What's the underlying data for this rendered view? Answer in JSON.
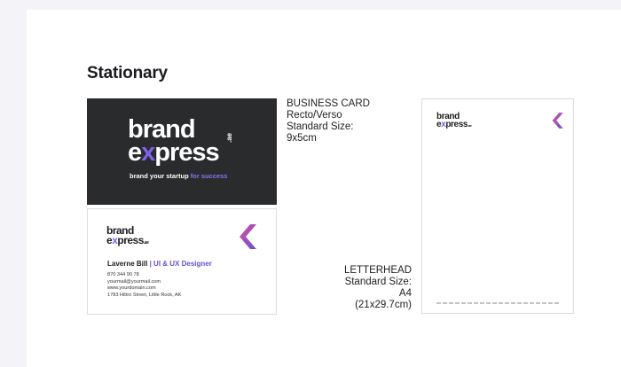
{
  "page": {
    "title": "Stationary"
  },
  "business_card": {
    "front": {
      "brand_line1": "brand",
      "brand_line2_pre": "e",
      "brand_line2_x": "x",
      "brand_line2_post": "press",
      "brand_suffix": ".ae",
      "tagline": "brand your startup",
      "tagline_accent": "for success"
    },
    "back": {
      "brand_line1": "brand",
      "brand_line2_pre": "e",
      "brand_line2_x": "x",
      "brand_line2_post": "press",
      "brand_suffix": ".ae",
      "name": "Laverne Bill",
      "separator": " | ",
      "role": "UI & UX Designer",
      "phone": "870 344 90 78",
      "email": "yourmail@yourmail.com",
      "website": "www.yourdomain.com",
      "address": "1783 Hittro Street, Little Rock, AK"
    },
    "label": {
      "line1": "BUSINESS CARD",
      "line2": "Recto/Verso",
      "line3": "Standard Size:",
      "line4": "9x5cm"
    }
  },
  "letterhead": {
    "brand_line1": "brand",
    "brand_line2_pre": "e",
    "brand_line2_x": "x",
    "brand_line2_post": "press",
    "brand_suffix": ".ae",
    "label": {
      "line1": "LETTERHEAD",
      "line2": "Standard Size:",
      "line3": "A4 (21x29.7cm)"
    }
  },
  "colors": {
    "brand_purple": "#7e63ea",
    "chevron_pink": "#d94f9a",
    "card_dark": "#2a2b2d"
  }
}
